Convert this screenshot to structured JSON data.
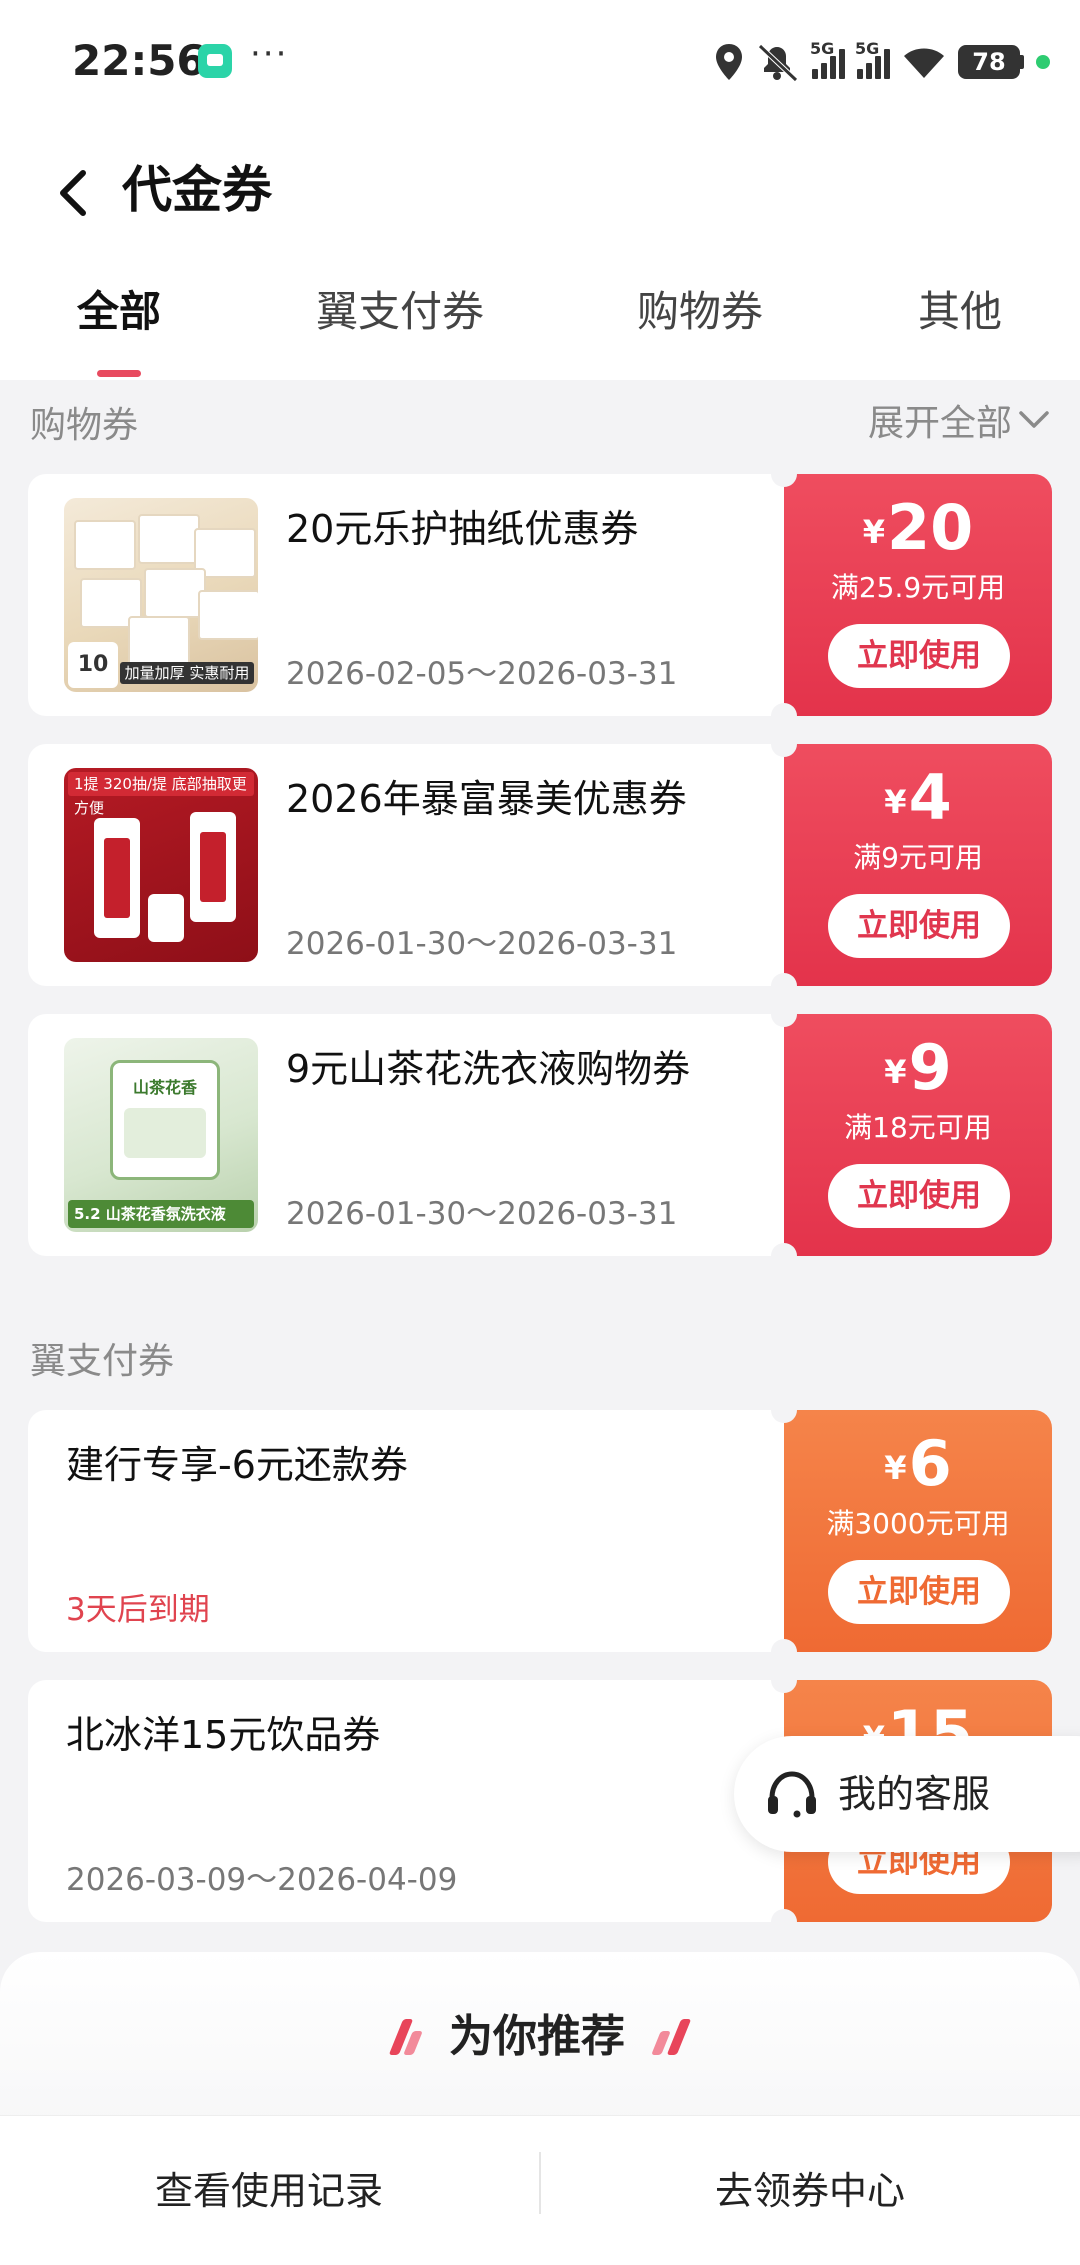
{
  "status_bar": {
    "time": "22:56",
    "more": "···",
    "network_1": "5G",
    "network_2": "5G",
    "battery": "78",
    "icons": [
      "chat-app-icon",
      "location-icon",
      "mute-icon",
      "signal-icon",
      "signal-icon",
      "wifi-icon",
      "battery-icon"
    ]
  },
  "header": {
    "title": "代金券",
    "back_icon": "chevron-left-icon"
  },
  "tabs": [
    {
      "label": "全部",
      "active": true
    },
    {
      "label": "翼支付券",
      "active": false
    },
    {
      "label": "购物券",
      "active": false
    },
    {
      "label": "其他",
      "active": false
    }
  ],
  "colors": {
    "accent_red": "#e84a5f",
    "coupon_red": "#e3334b",
    "coupon_orange": "#ef6a33"
  },
  "shopping_section": {
    "label": "购物券",
    "expand_label": "展开全部",
    "coupons": [
      {
        "title": "20元乐护抽纸优惠券",
        "date_range": "2026-02-05～2026-03-31",
        "currency": "¥",
        "amount": "20",
        "condition": "满25.9元可用",
        "button": "立即使用",
        "thumb": {
          "badge": "10",
          "band": "加量加厚 实惠耐用"
        }
      },
      {
        "title": "2026年暴富暴美优惠券",
        "date_range": "2026-01-30～2026-03-31",
        "currency": "¥",
        "amount": "4",
        "condition": "满9元可用",
        "button": "立即使用",
        "thumb": {
          "tag": "1提 320抽/提 底部抽取更方便"
        }
      },
      {
        "title": "9元山茶花洗衣液购物券",
        "date_range": "2026-01-30～2026-03-31",
        "currency": "¥",
        "amount": "9",
        "condition": "满18元可用",
        "button": "立即使用",
        "thumb": {
          "bag_title": "山茶花香",
          "price_tag": "5.2 山茶花香氛洗衣液"
        }
      }
    ]
  },
  "yizhifu_section": {
    "label": "翼支付券",
    "coupons": [
      {
        "title": "建行专享-6元还款券",
        "expire_text": "3天后到期",
        "currency": "¥",
        "amount": "6",
        "condition": "满3000元可用",
        "button": "立即使用"
      },
      {
        "title": "北冰洋15元饮品券",
        "date_range": "2026-03-09～2026-04-09",
        "currency": "¥",
        "amount": "15",
        "condition": "",
        "button": "立即使用"
      }
    ]
  },
  "customer_service": {
    "label": "我的客服",
    "icon": "headset-icon"
  },
  "recommend": {
    "title": "为你推荐"
  },
  "bottom_bar": {
    "left_label": "查看使用记录",
    "right_label": "去领券中心"
  }
}
